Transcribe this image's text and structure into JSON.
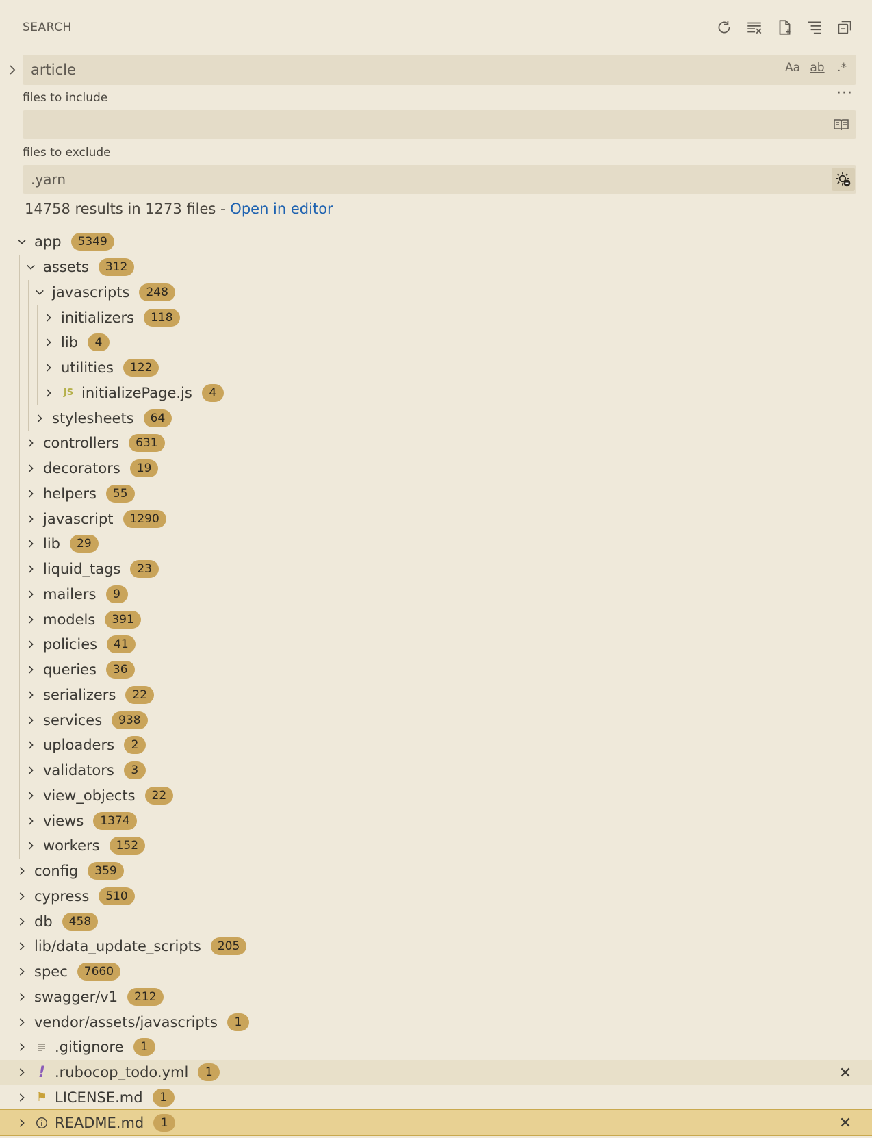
{
  "header": {
    "title": "SEARCH",
    "icons": [
      "refresh-icon",
      "clear-results-icon",
      "new-search-editor-icon",
      "view-as-tree-icon",
      "collapse-all-icon"
    ]
  },
  "search": {
    "query": "article",
    "opt_case": "Aa",
    "opt_word": "ab",
    "opt_regex": ".*"
  },
  "include": {
    "label": "files to include",
    "value": ""
  },
  "exclude": {
    "label": "files to exclude",
    "value": ".yarn"
  },
  "summary": {
    "text": "14758 results in 1273 files - ",
    "link": "Open in editor"
  },
  "tree": [
    {
      "name": "app",
      "count": "5349",
      "depth": 0,
      "expanded": true
    },
    {
      "name": "assets",
      "count": "312",
      "depth": 1,
      "expanded": true
    },
    {
      "name": "javascripts",
      "count": "248",
      "depth": 2,
      "expanded": true
    },
    {
      "name": "initializers",
      "count": "118",
      "depth": 3
    },
    {
      "name": "lib",
      "count": "4",
      "depth": 3
    },
    {
      "name": "utilities",
      "count": "122",
      "depth": 3
    },
    {
      "name": "initializePage.js",
      "count": "4",
      "depth": 3,
      "icon": "js"
    },
    {
      "name": "stylesheets",
      "count": "64",
      "depth": 2
    },
    {
      "name": "controllers",
      "count": "631",
      "depth": 1
    },
    {
      "name": "decorators",
      "count": "19",
      "depth": 1
    },
    {
      "name": "helpers",
      "count": "55",
      "depth": 1
    },
    {
      "name": "javascript",
      "count": "1290",
      "depth": 1
    },
    {
      "name": "lib",
      "count": "29",
      "depth": 1
    },
    {
      "name": "liquid_tags",
      "count": "23",
      "depth": 1
    },
    {
      "name": "mailers",
      "count": "9",
      "depth": 1
    },
    {
      "name": "models",
      "count": "391",
      "depth": 1
    },
    {
      "name": "policies",
      "count": "41",
      "depth": 1
    },
    {
      "name": "queries",
      "count": "36",
      "depth": 1
    },
    {
      "name": "serializers",
      "count": "22",
      "depth": 1
    },
    {
      "name": "services",
      "count": "938",
      "depth": 1
    },
    {
      "name": "uploaders",
      "count": "2",
      "depth": 1
    },
    {
      "name": "validators",
      "count": "3",
      "depth": 1
    },
    {
      "name": "view_objects",
      "count": "22",
      "depth": 1
    },
    {
      "name": "views",
      "count": "1374",
      "depth": 1
    },
    {
      "name": "workers",
      "count": "152",
      "depth": 1
    },
    {
      "name": "config",
      "count": "359",
      "depth": 0
    },
    {
      "name": "cypress",
      "count": "510",
      "depth": 0
    },
    {
      "name": "db",
      "count": "458",
      "depth": 0
    },
    {
      "name": "lib/data_update_scripts",
      "count": "205",
      "depth": 0
    },
    {
      "name": "spec",
      "count": "7660",
      "depth": 0
    },
    {
      "name": "swagger/v1",
      "count": "212",
      "depth": 0
    },
    {
      "name": "vendor/assets/javascripts",
      "count": "1",
      "depth": 0
    },
    {
      "name": ".gitignore",
      "count": "1",
      "depth": 0,
      "icon": "lines"
    },
    {
      "name": ".rubocop_todo.yml",
      "count": "1",
      "depth": 0,
      "icon": "exclaim",
      "state": "hover"
    },
    {
      "name": "LICENSE.md",
      "count": "1",
      "depth": 0,
      "icon": "license"
    },
    {
      "name": "README.md",
      "count": "1",
      "depth": 0,
      "icon": "info",
      "state": "selected"
    }
  ],
  "colors": {
    "background": "#efe9da",
    "badge": "#c9a45a",
    "link": "#1e62b0",
    "selected": "#e8d193"
  }
}
